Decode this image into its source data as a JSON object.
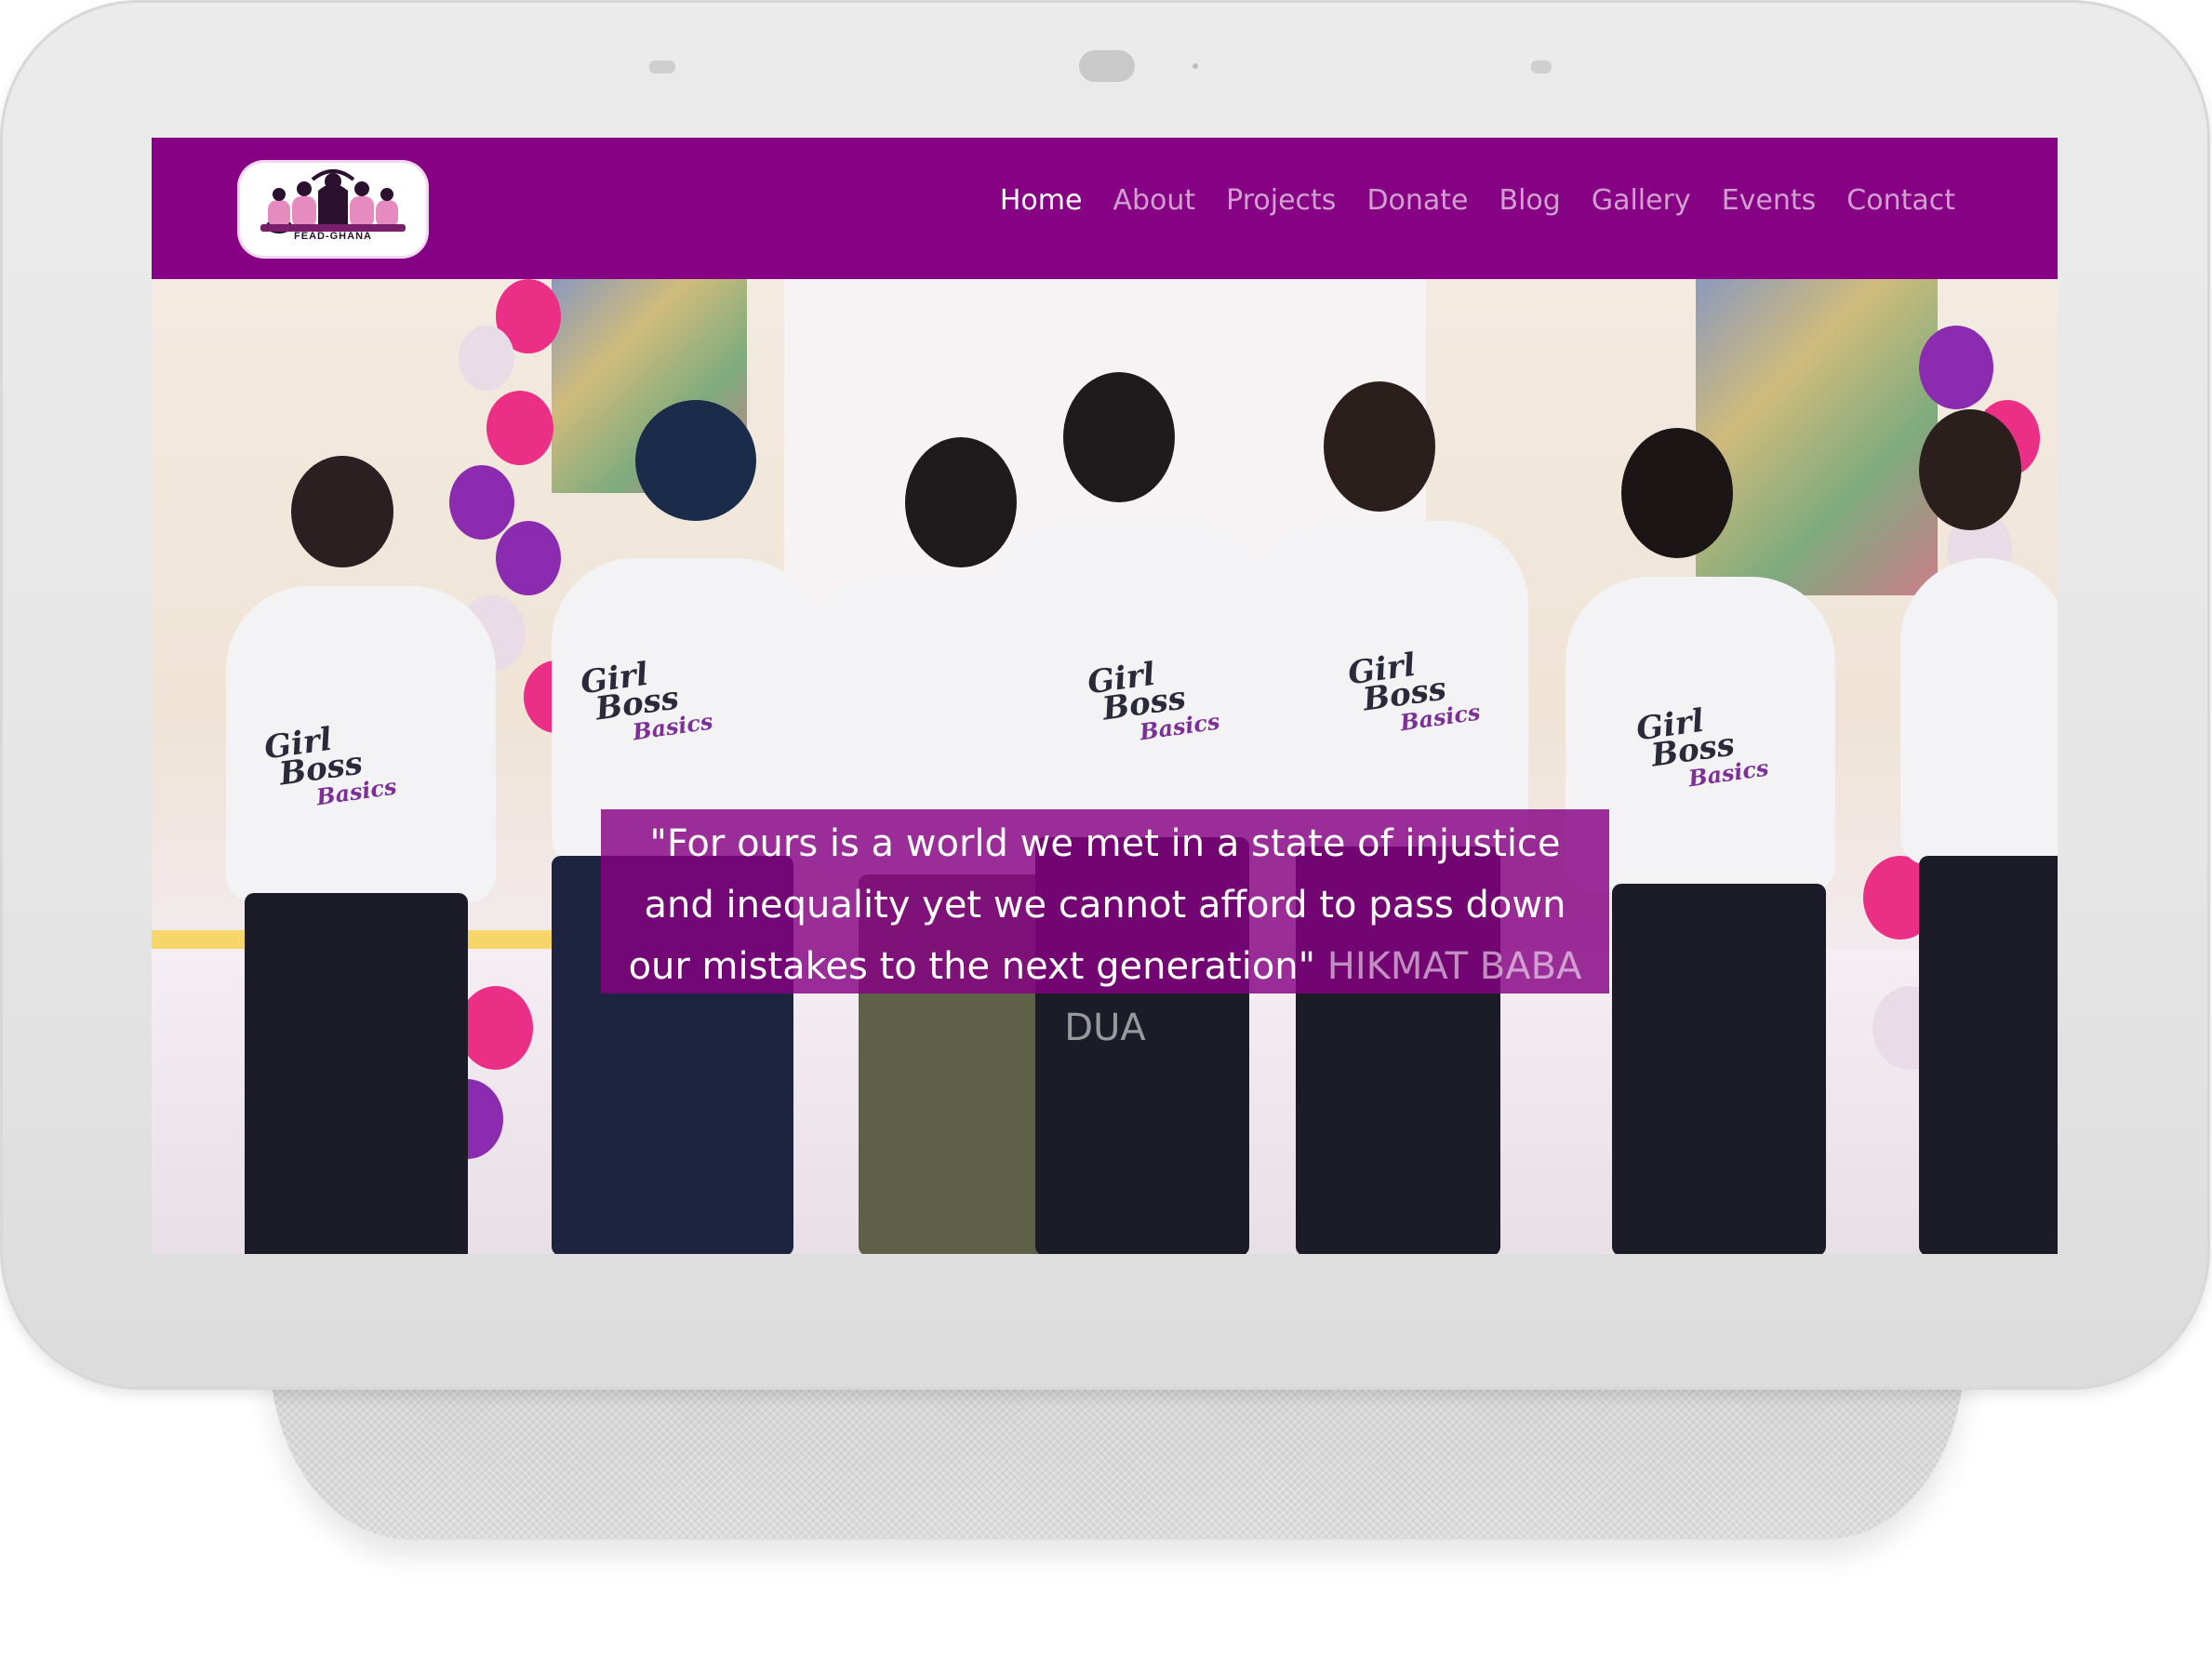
{
  "brand": {
    "logo_text": "FEAD-GHANA",
    "primary_color": "#860183"
  },
  "nav": {
    "items": [
      {
        "label": "Home",
        "active": true
      },
      {
        "label": "About",
        "active": false
      },
      {
        "label": "Projects",
        "active": false
      },
      {
        "label": "Donate",
        "active": false
      },
      {
        "label": "Blog",
        "active": false
      },
      {
        "label": "Gallery",
        "active": false
      },
      {
        "label": "Events",
        "active": false
      },
      {
        "label": "Contact",
        "active": false
      }
    ]
  },
  "hero": {
    "quote": "\"For ours is a world we met in a state of injustice and inequality yet we cannot afford to pass down our mistakes to the next generation\"",
    "author": "HIKMAT BABA DUA",
    "shirt_print": {
      "line1": "Girl",
      "line2": "Boss",
      "line3": "Basics"
    }
  }
}
